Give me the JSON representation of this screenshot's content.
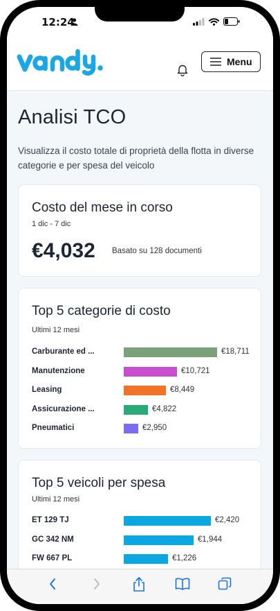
{
  "status": {
    "time": "12:24"
  },
  "header": {
    "logo_text": "vandy.",
    "menu_label": "Menu"
  },
  "page": {
    "title": "Analisi TCO",
    "subtitle": "Visualizza il costo totale di proprietà della flotta in diverse categorie e per spesa del veicolo"
  },
  "month_card": {
    "title": "Costo del mese in corso",
    "period": "1 dic - 7 dic",
    "amount": "€4,032",
    "basis": "Basato su 128 documenti"
  },
  "categories_card": {
    "title": "Top 5 categorie di costo",
    "period": "Ultimi 12 mesi"
  },
  "vehicles_card": {
    "title": "Top 5 veicoli per spesa",
    "period": "Ultimi 12 mesi"
  },
  "chart_data": [
    {
      "type": "bar",
      "orientation": "horizontal",
      "title": "Top 5 categorie di costo",
      "categories": [
        "Carburante ed ...",
        "Manutenzione",
        "Leasing",
        "Assicurazione ...",
        "Pneumatici"
      ],
      "values": [
        18711,
        10721,
        8449,
        4822,
        2950
      ],
      "value_labels": [
        "€18,711",
        "€10,721",
        "€8,449",
        "€4,822",
        "€2,950"
      ],
      "colors": [
        "#7aa17a",
        "#c94fd0",
        "#f2722a",
        "#2aaa77",
        "#7b6cf4"
      ]
    },
    {
      "type": "bar",
      "orientation": "horizontal",
      "title": "Top 5 veicoli per spesa",
      "categories": [
        "ET 129 TJ",
        "GC 342 NM",
        "FW 667 PL"
      ],
      "values": [
        2420,
        1944,
        1226
      ],
      "value_labels": [
        "€2,420",
        "€1,944",
        "€1,226"
      ],
      "colors": [
        "#0aa7e0",
        "#0aa7e0",
        "#0aa7e0"
      ]
    }
  ],
  "colors": {
    "brand": "#1ba7e3",
    "text": "#1d2433",
    "background": "#f4f7fa"
  },
  "toolbar": {
    "icons": [
      "back-icon",
      "forward-icon",
      "share-icon",
      "bookmarks-icon",
      "tabs-icon"
    ]
  }
}
